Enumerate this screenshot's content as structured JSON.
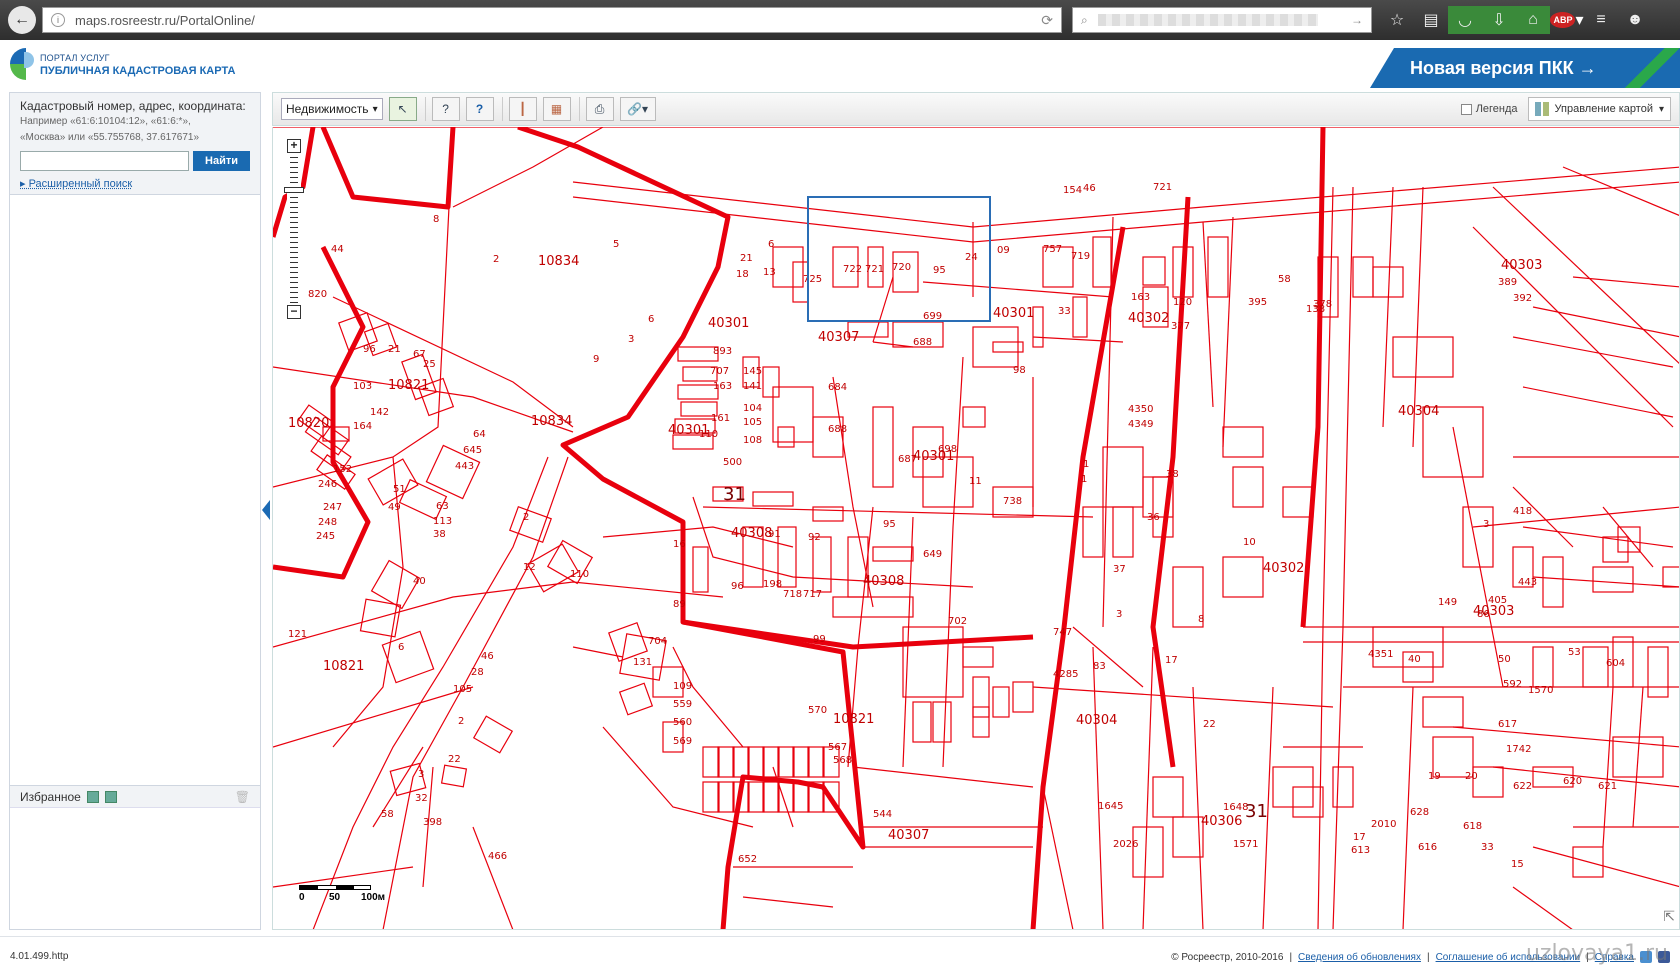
{
  "browser": {
    "url": "maps.rosreestr.ru/PortalOnline/",
    "reload_icon": "reload-icon",
    "search_placeholder": "",
    "toolbar_icons": [
      "star-icon",
      "reading-list-icon",
      "pocket-icon",
      "download-icon",
      "home-icon",
      "adblock-icon",
      "menu-icon",
      "smiley-icon"
    ],
    "adblock_label": "ABP"
  },
  "portal": {
    "small_label": "ПОРТАЛ УСЛУГ",
    "title": "ПУБЛИЧНАЯ КАДАСТРОВАЯ КАРТА",
    "new_version_label": "Новая версия ПКК →",
    "brand_color": "#1a6ab1",
    "accent_color": "#2aa84a"
  },
  "search": {
    "label": "Кадастровый номер, адрес, координата:",
    "example_line1": "Например «61:6:10104:12», «61:6:*»,",
    "example_line2": "«Москва» или «55.755768, 37.617671»",
    "input_value": "",
    "find_button": "Найти",
    "advanced_link": "Расширенный поиск"
  },
  "favorites": {
    "title": "Избранное"
  },
  "toolbar": {
    "layer_select": "Недвижимость",
    "tools": [
      "select-icon",
      "identify-icon",
      "info-icon",
      "measure-length-icon",
      "measure-area-icon",
      "print-icon",
      "link-icon"
    ],
    "legend_label": "Легенда",
    "legend_checked": false,
    "map_control_label": "Управление картой"
  },
  "map": {
    "line_color": "#e8000d",
    "selection_color": "#2a6db5",
    "labels": [
      {
        "t": "8"
      },
      {
        "t": "2"
      },
      {
        "t": "10834"
      },
      {
        "t": "5"
      },
      {
        "t": "44"
      },
      {
        "t": "820"
      },
      {
        "t": "40301"
      },
      {
        "t": "6"
      },
      {
        "t": "3"
      },
      {
        "t": "9"
      },
      {
        "t": "96"
      },
      {
        "t": "21"
      },
      {
        "t": "67"
      },
      {
        "t": "25"
      },
      {
        "t": "103"
      },
      {
        "t": "10821"
      },
      {
        "t": "142"
      },
      {
        "t": "164"
      },
      {
        "t": "10820"
      },
      {
        "t": "10834"
      },
      {
        "t": "64"
      },
      {
        "t": "645"
      },
      {
        "t": "443"
      },
      {
        "t": "152"
      },
      {
        "t": "246"
      },
      {
        "t": "247"
      },
      {
        "t": "248"
      },
      {
        "t": "245"
      },
      {
        "t": "51"
      },
      {
        "t": "49"
      },
      {
        "t": "63"
      },
      {
        "t": "113"
      },
      {
        "t": "38"
      },
      {
        "t": "2"
      },
      {
        "t": "12"
      },
      {
        "t": "110"
      },
      {
        "t": "40"
      },
      {
        "t": "121"
      },
      {
        "t": "6"
      },
      {
        "t": "10821"
      },
      {
        "t": "46"
      },
      {
        "t": "28"
      },
      {
        "t": "105"
      },
      {
        "t": "2"
      },
      {
        "t": "22"
      },
      {
        "t": "3"
      },
      {
        "t": "32"
      },
      {
        "t": "58"
      },
      {
        "t": "398"
      },
      {
        "t": "466"
      },
      {
        "t": "893"
      },
      {
        "t": "707"
      },
      {
        "t": "145"
      },
      {
        "t": "163"
      },
      {
        "t": "141"
      },
      {
        "t": "104"
      },
      {
        "t": "161"
      },
      {
        "t": "105"
      },
      {
        "t": "40301"
      },
      {
        "t": "110"
      },
      {
        "t": "108"
      },
      {
        "t": "500"
      },
      {
        "t": "31"
      },
      {
        "t": "40308"
      },
      {
        "t": "91"
      },
      {
        "t": "92"
      },
      {
        "t": "16"
      },
      {
        "t": "198"
      },
      {
        "t": "89"
      },
      {
        "t": "96"
      },
      {
        "t": "718"
      },
      {
        "t": "717"
      },
      {
        "t": "95"
      },
      {
        "t": "40308"
      },
      {
        "t": "649"
      },
      {
        "t": "702"
      },
      {
        "t": "704"
      },
      {
        "t": "131"
      },
      {
        "t": "99"
      },
      {
        "t": "109"
      },
      {
        "t": "559"
      },
      {
        "t": "560"
      },
      {
        "t": "569"
      },
      {
        "t": "570"
      },
      {
        "t": "10821"
      },
      {
        "t": "567"
      },
      {
        "t": "568"
      },
      {
        "t": "544"
      },
      {
        "t": "40307"
      },
      {
        "t": "652"
      },
      {
        "t": "40307"
      },
      {
        "t": "684"
      },
      {
        "t": "688"
      },
      {
        "t": "688"
      },
      {
        "t": "699"
      },
      {
        "t": "40301"
      },
      {
        "t": "98"
      },
      {
        "t": "698"
      },
      {
        "t": "11"
      },
      {
        "t": "687"
      },
      {
        "t": "40301"
      },
      {
        "t": "738"
      },
      {
        "t": "747"
      },
      {
        "t": "757"
      },
      {
        "t": "33"
      },
      {
        "t": "154"
      },
      {
        "t": "46"
      },
      {
        "t": "721"
      },
      {
        "t": "163"
      },
      {
        "t": "120"
      },
      {
        "t": "377"
      },
      {
        "t": "40302"
      },
      {
        "t": "395"
      },
      {
        "t": "58"
      },
      {
        "t": "138"
      },
      {
        "t": "378"
      },
      {
        "t": "40303"
      },
      {
        "t": "389"
      },
      {
        "t": "392"
      },
      {
        "t": "40304"
      },
      {
        "t": "4350"
      },
      {
        "t": "4349"
      },
      {
        "t": "1"
      },
      {
        "t": "1"
      },
      {
        "t": "38"
      },
      {
        "t": "36"
      },
      {
        "t": "37"
      },
      {
        "t": "3"
      },
      {
        "t": "8"
      },
      {
        "t": "10"
      },
      {
        "t": "40302"
      },
      {
        "t": "3"
      },
      {
        "t": "418"
      },
      {
        "t": "443"
      },
      {
        "t": "40303"
      },
      {
        "t": "149"
      },
      {
        "t": "405"
      },
      {
        "t": "86"
      },
      {
        "t": "4285"
      },
      {
        "t": "40304"
      },
      {
        "t": "83"
      },
      {
        "t": "17"
      },
      {
        "t": "22"
      },
      {
        "t": "4351"
      },
      {
        "t": "40"
      },
      {
        "t": "50"
      },
      {
        "t": "53"
      },
      {
        "t": "604"
      },
      {
        "t": "592"
      },
      {
        "t": "1570"
      },
      {
        "t": "617"
      },
      {
        "t": "1742"
      },
      {
        "t": "622"
      },
      {
        "t": "620"
      },
      {
        "t": "621"
      },
      {
        "t": "19"
      },
      {
        "t": "20"
      },
      {
        "t": "1645"
      },
      {
        "t": "1648"
      },
      {
        "t": "40306"
      },
      {
        "t": "31"
      },
      {
        "t": "1571"
      },
      {
        "t": "2026"
      },
      {
        "t": "17"
      },
      {
        "t": "613"
      },
      {
        "t": "628"
      },
      {
        "t": "2010"
      },
      {
        "t": "616"
      },
      {
        "t": "618"
      },
      {
        "t": "15"
      },
      {
        "t": "33"
      },
      {
        "t": "725"
      },
      {
        "t": "722"
      },
      {
        "t": "721"
      },
      {
        "t": "720"
      },
      {
        "t": "18"
      },
      {
        "t": "21"
      },
      {
        "t": "24"
      },
      {
        "t": "09"
      },
      {
        "t": "719"
      },
      {
        "t": "95"
      },
      {
        "t": "13"
      },
      {
        "t": "6"
      }
    ]
  },
  "scale": {
    "l0": "0",
    "l1": "50",
    "l2": "100м"
  },
  "footer": {
    "version": "4.01.499.http",
    "copyright": "© Росреестр, 2010-2016",
    "updates_link": "Сведения об обновлениях",
    "agreement_link": "Соглашение об использовании",
    "help_link": "Справка",
    "watermark": "uzlovaya1.ru"
  }
}
